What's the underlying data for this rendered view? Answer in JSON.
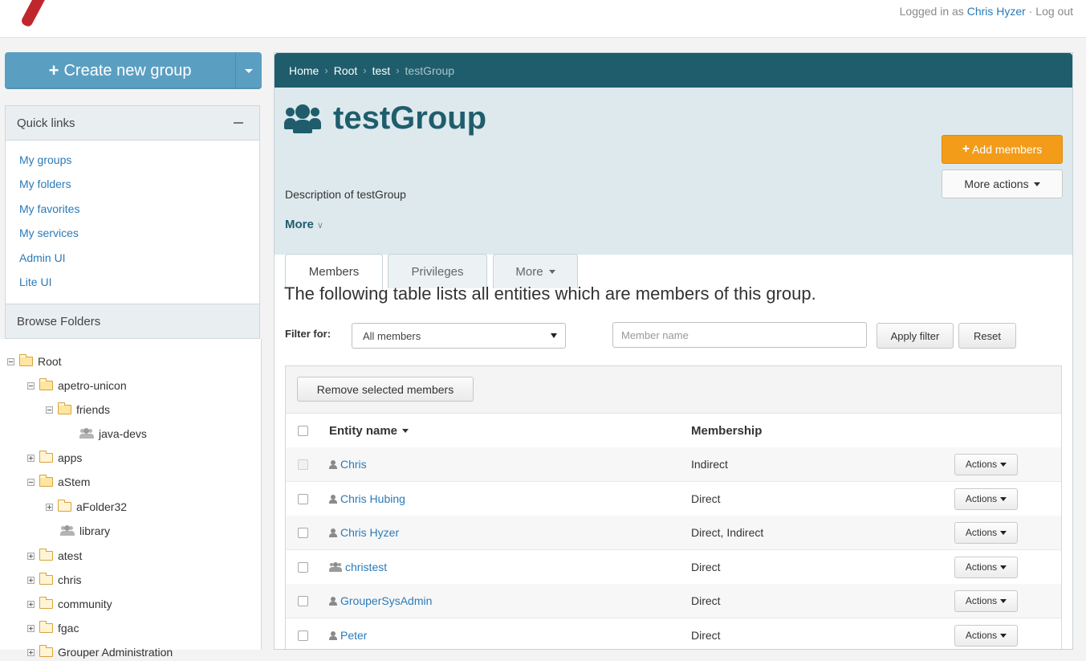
{
  "topbar": {
    "logged_in_prefix": "Logged in as",
    "user_name": "Chris Hyzer",
    "separator": "·",
    "logout": "Log out"
  },
  "sidebar": {
    "create_button": "Create new group",
    "quick_links_title": "Quick links",
    "quick_links": [
      "My groups",
      "My folders",
      "My favorites",
      "My services",
      "Admin UI",
      "Lite UI"
    ],
    "browse_title": "Browse Folders",
    "tree": [
      {
        "label": "Root"
      },
      {
        "label": "apetro-unicon"
      },
      {
        "label": "friends"
      },
      {
        "label": "java-devs"
      },
      {
        "label": "apps"
      },
      {
        "label": "aStem"
      },
      {
        "label": "aFolder32"
      },
      {
        "label": "library"
      },
      {
        "label": "atest"
      },
      {
        "label": "chris"
      },
      {
        "label": "community"
      },
      {
        "label": "fgac"
      },
      {
        "label": "Grouper Administration"
      }
    ]
  },
  "breadcrumb": {
    "home": "Home",
    "root": "Root",
    "test": "test",
    "current": "testGroup",
    "sep": "›"
  },
  "group": {
    "title": "testGroup",
    "description": "Description of testGroup",
    "more": "More",
    "add_members": "Add members",
    "more_actions": "More actions"
  },
  "tabs": {
    "members": "Members",
    "privileges": "Privileges",
    "more": "More"
  },
  "members": {
    "lead": "The following table lists all entities which are members of this group.",
    "filter_label": "Filter for:",
    "filter_value": "All members",
    "search_placeholder": "Member name",
    "apply_filter": "Apply filter",
    "reset": "Reset",
    "remove_selected": "Remove selected members",
    "col_entity": "Entity name",
    "col_membership": "Membership",
    "rows": [
      {
        "name": "Chris",
        "membership": "Indirect",
        "action": "Actions"
      },
      {
        "name": "Chris Hubing",
        "membership": "Direct",
        "action": "Actions"
      },
      {
        "name": "Chris Hyzer",
        "membership": "Direct, Indirect",
        "action": "Actions"
      },
      {
        "name": "christest",
        "membership": "Direct",
        "action": "Actions"
      },
      {
        "name": "GrouperSysAdmin",
        "membership": "Direct",
        "action": "Actions"
      },
      {
        "name": "Peter",
        "membership": "Direct",
        "action": "Actions"
      }
    ]
  }
}
